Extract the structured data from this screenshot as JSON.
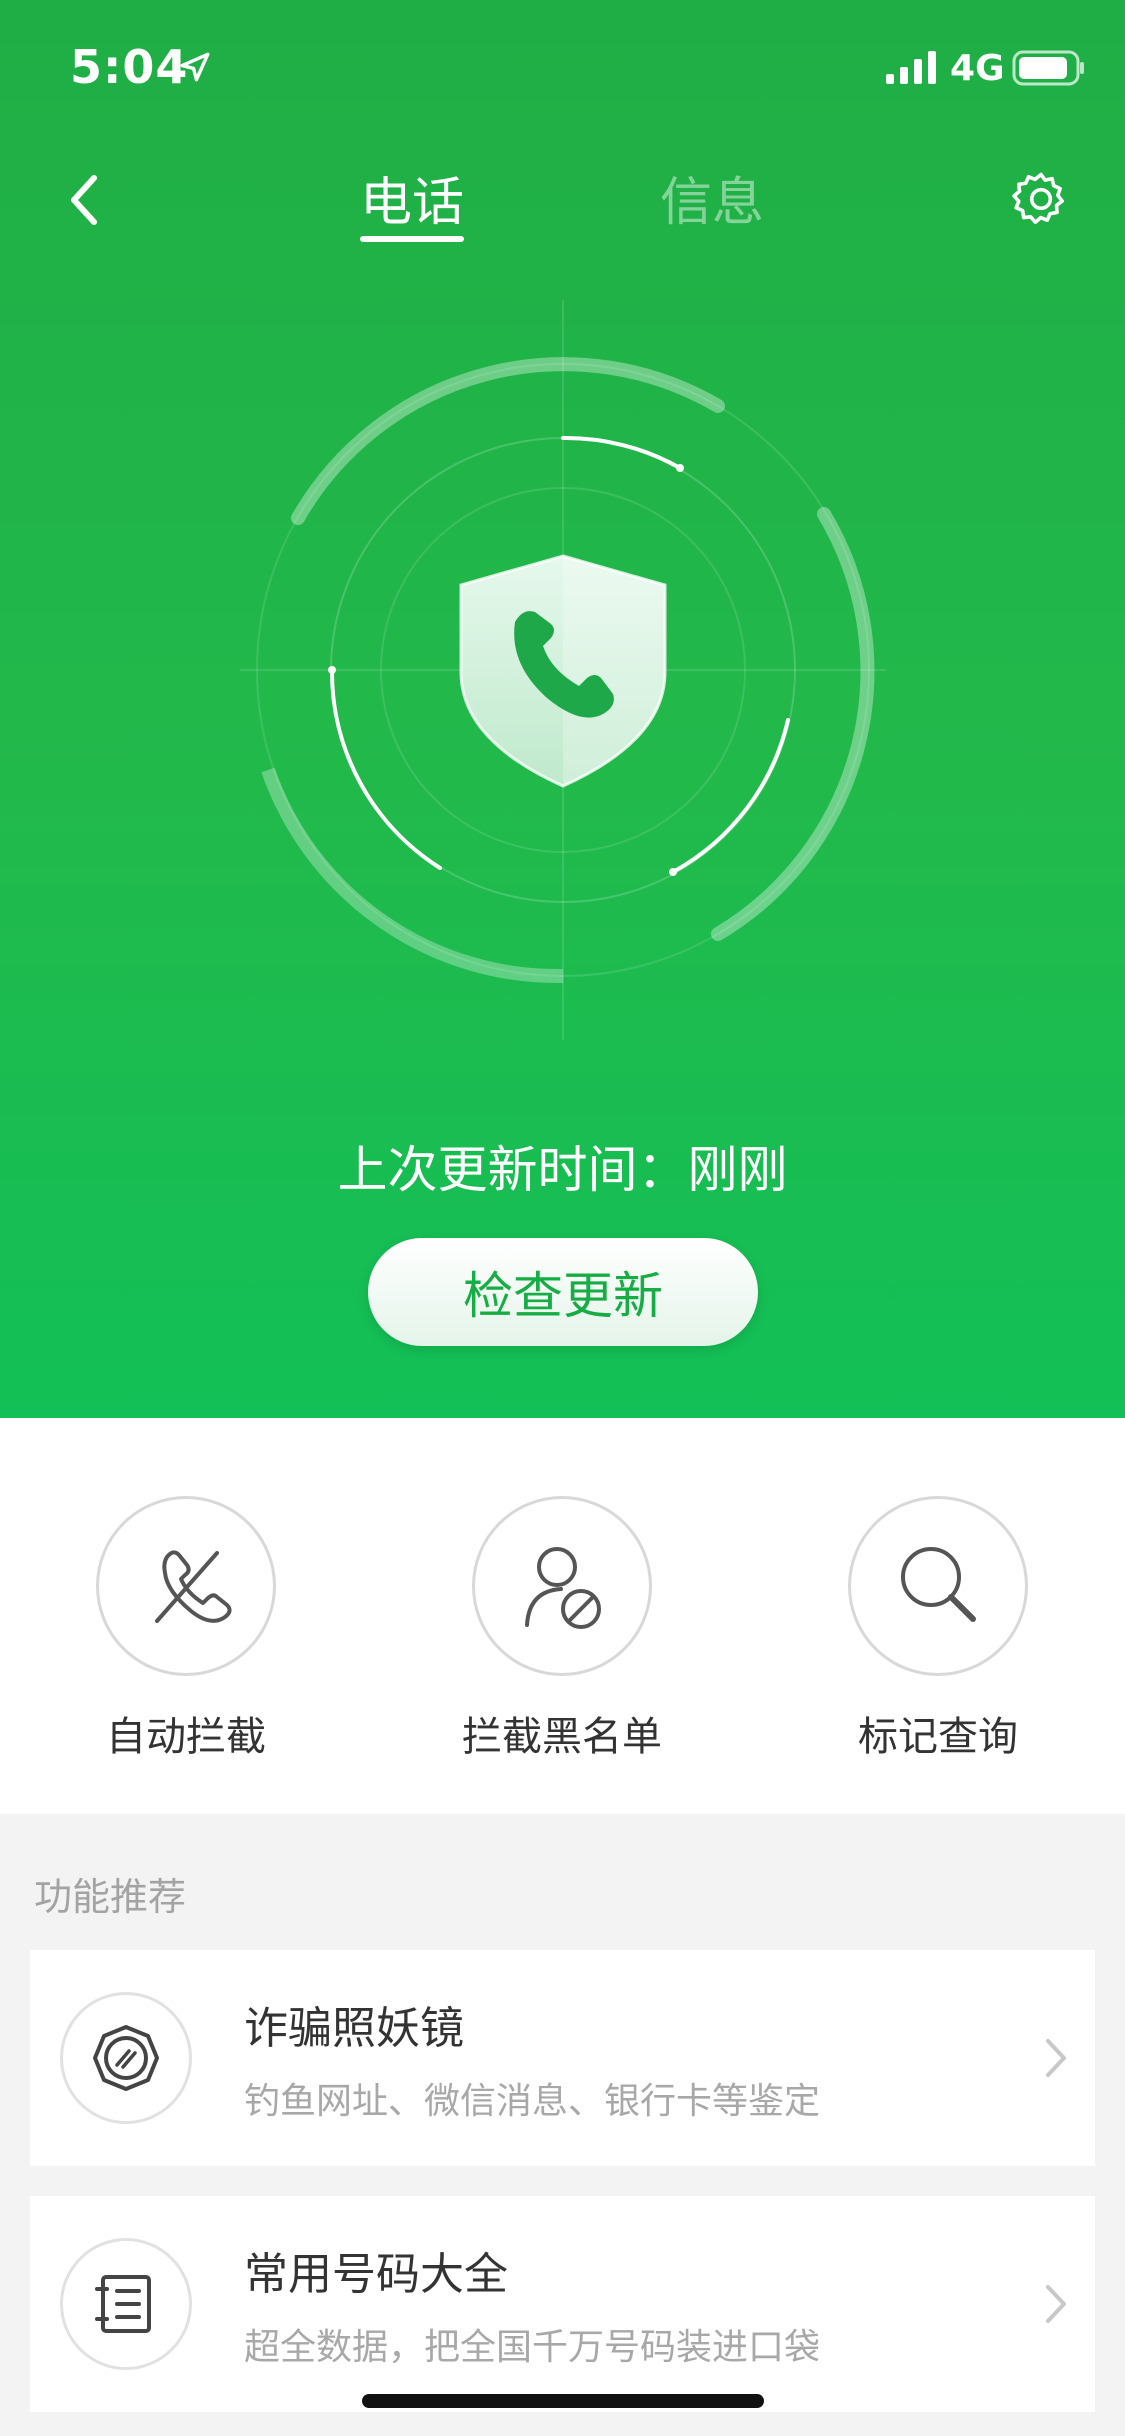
{
  "status_bar": {
    "time": "5:04",
    "network": "4G"
  },
  "nav": {
    "tabs": [
      {
        "label": "电话",
        "active": true
      },
      {
        "label": "信息",
        "active": false
      }
    ]
  },
  "hero": {
    "update_time_text": "上次更新时间：刚刚",
    "check_update_label": "检查更新",
    "accent_color": "#22b94b"
  },
  "actions": [
    {
      "label": "自动拦截",
      "icon": "phone-block-icon"
    },
    {
      "label": "拦截黑名单",
      "icon": "user-block-icon"
    },
    {
      "label": "标记查询",
      "icon": "search-icon"
    }
  ],
  "recommend": {
    "section_title": "功能推荐",
    "items": [
      {
        "title": "诈骗照妖镜",
        "desc": "钓鱼网址、微信消息、银行卡等鉴定",
        "icon": "mirror-icon"
      },
      {
        "title": "常用号码大全",
        "desc": "超全数据，把全国千万号码装进口袋",
        "icon": "phonebook-icon"
      }
    ]
  }
}
